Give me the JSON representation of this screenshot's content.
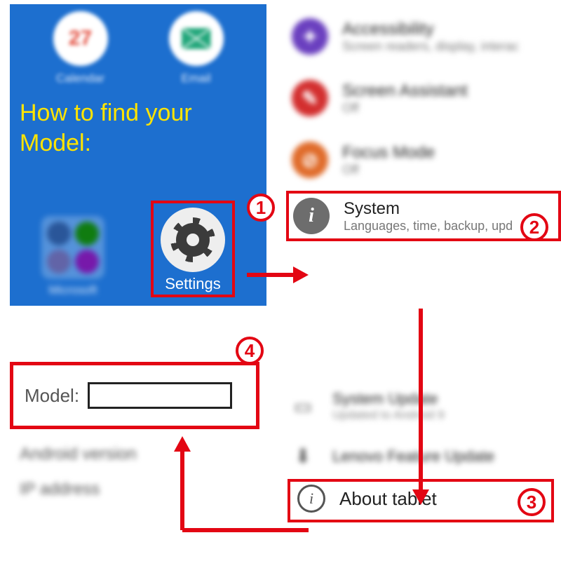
{
  "instruction": "How to find your Model:",
  "homescreen": {
    "apps": {
      "calendar_label": "Calendar",
      "calendar_date": "27",
      "email_label": "Email",
      "microsoft_label": "Microsoft",
      "settings_label": "Settings"
    }
  },
  "settings_list": {
    "accessibility": {
      "title": "Accessibility",
      "sub": "Screen readers, display, interac"
    },
    "screen_assistant": {
      "title": "Screen Assistant",
      "sub": "Off"
    },
    "focus_mode": {
      "title": "Focus Mode",
      "sub": "Off"
    },
    "system": {
      "title": "System",
      "sub": "Languages, time, backup, upd"
    }
  },
  "system_page": {
    "update": {
      "title": "System Update",
      "sub": "Updated to Android 9"
    },
    "feature": {
      "title": "Lenovo Feature Update"
    },
    "about": {
      "title": "About tablet"
    }
  },
  "about_page": {
    "model_label": "Model:",
    "android_version": "Android version",
    "ip_address": "IP address"
  },
  "steps": {
    "s1": "1",
    "s2": "2",
    "s3": "3",
    "s4": "4"
  }
}
